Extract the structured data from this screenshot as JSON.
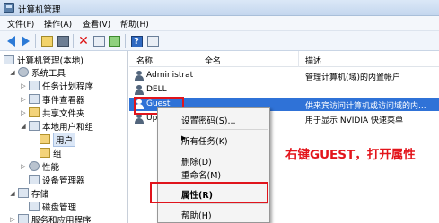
{
  "window": {
    "title": "计算机管理"
  },
  "menu": [
    "文件(F)",
    "操作(A)",
    "查看(V)",
    "帮助(H)"
  ],
  "tree": {
    "root": "计算机管理(本地)",
    "system_tools": "系统工具",
    "task_scheduler": "任务计划程序",
    "event_viewer": "事件查看器",
    "shared_folders": "共享文件夹",
    "local_users_groups": "本地用户和组",
    "users": "用户",
    "groups": "组",
    "performance": "性能",
    "device_manager": "设备管理器",
    "storage": "存储",
    "disk_management": "磁盘管理",
    "services_apps": "服务和应用程序"
  },
  "list": {
    "columns": [
      "名称",
      "全名",
      "描述"
    ],
    "rows": [
      {
        "name": "Administrat",
        "fullname": "",
        "desc": "管理计算机(域)的内置帐户"
      },
      {
        "name": "DELL",
        "fullname": "",
        "desc": ""
      },
      {
        "name": "Guest",
        "fullname": "",
        "desc": "供来宾访问计算机或访问域的内..."
      },
      {
        "name": "Up",
        "fullname": "",
        "desc": "用于显示 NVIDIA 快速菜单"
      }
    ]
  },
  "context_menu": {
    "set_password": "设置密码(S)...",
    "all_tasks": "所有任务(K)",
    "delete": "删除(D)",
    "rename": "重命名(M)",
    "properties": "属性(R)",
    "help": "帮助(H)"
  },
  "annotation": "右键GUEST，打开属性",
  "colors": {
    "selection": "#2f72d7",
    "highlight_box": "#e0141c",
    "annotation": "#e3141b"
  }
}
